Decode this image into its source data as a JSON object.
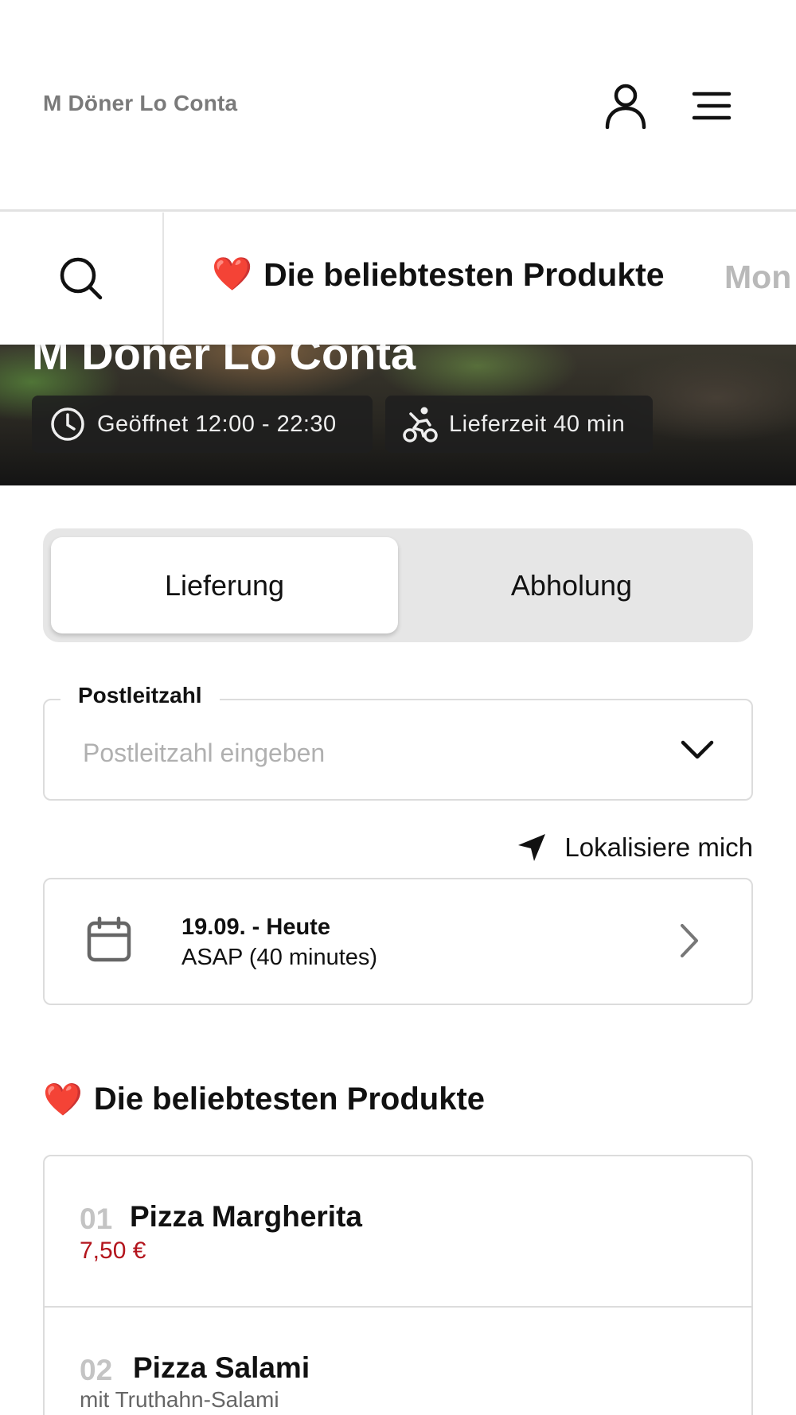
{
  "header": {
    "brand": "M Döner Lo Conta",
    "user_icon": "user-icon",
    "menu_icon": "hamburger-menu-icon"
  },
  "category_bar": {
    "search_icon": "search-icon",
    "active_emoji": "❤️",
    "active_label": "Die beliebtesten Produkte",
    "next_label": "Mon"
  },
  "hero": {
    "title": "M Döner Lo Conta",
    "opening": "Geöffnet 12:00 - 22:30",
    "delivery_time": "Lieferzeit 40 min"
  },
  "order_mode": {
    "delivery_label": "Lieferung",
    "pickup_label": "Abholung",
    "selected": "Lieferung"
  },
  "postal_code": {
    "label": "Postleitzahl",
    "placeholder": "Postleitzahl eingeben",
    "value": ""
  },
  "locate": {
    "label": "Lokalisiere mich"
  },
  "schedule": {
    "date": "19.09. - Heute",
    "time": "ASAP (40 minutes)"
  },
  "section": {
    "emoji": "❤️",
    "title": "Die beliebtesten Produkte"
  },
  "products": [
    {
      "number": "01",
      "name": "Pizza Margherita",
      "price": "7,50 €"
    },
    {
      "number": "02",
      "name": "Pizza Salami",
      "description": "mit Truthahn-Salami"
    }
  ],
  "colors": {
    "price": "#b3141c",
    "muted": "#b9b9b9",
    "toggle_bg": "#e6e6e6"
  }
}
